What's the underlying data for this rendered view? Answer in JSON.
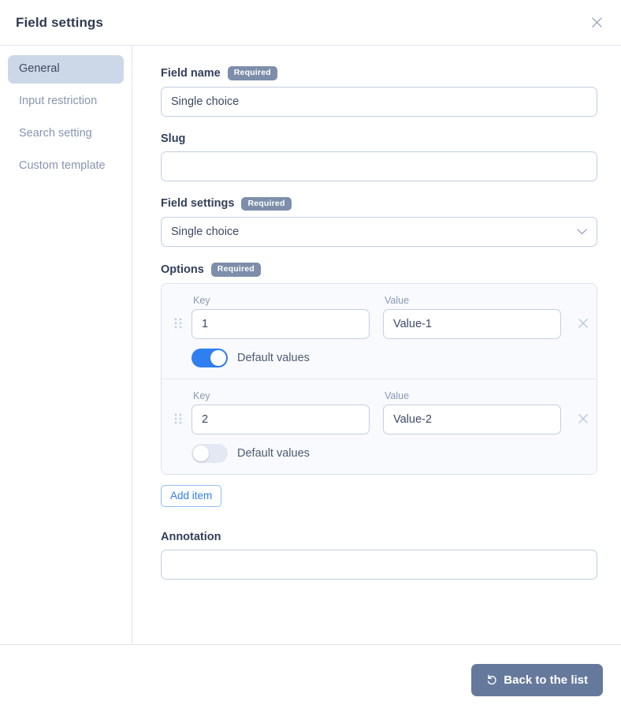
{
  "header": {
    "title": "Field settings",
    "close_icon": "close-icon"
  },
  "sidebar": {
    "items": [
      {
        "label": "General",
        "active": true
      },
      {
        "label": "Input restriction",
        "active": false
      },
      {
        "label": "Search setting",
        "active": false
      },
      {
        "label": "Custom template",
        "active": false
      }
    ]
  },
  "main": {
    "required_badge": "Required",
    "field_name": {
      "label": "Field name",
      "value": "Single choice",
      "placeholder": ""
    },
    "slug": {
      "label": "Slug",
      "value": "",
      "placeholder": ""
    },
    "field_settings": {
      "label": "Field settings",
      "value": "Single choice",
      "chevron_icon": "chevron-down-icon"
    },
    "options": {
      "label": "Options",
      "key_label": "Key",
      "value_label": "Value",
      "toggle_label": "Default values",
      "drag_icon": "drag-handle-icon",
      "remove_icon": "close-icon",
      "rows": [
        {
          "key": "1",
          "value": "Value-1",
          "default_on": true
        },
        {
          "key": "2",
          "value": "Value-2",
          "default_on": false
        }
      ],
      "add_item_label": "Add item"
    },
    "annotation": {
      "label": "Annotation",
      "value": "",
      "placeholder": ""
    }
  },
  "footer": {
    "back_label": "Back to the list",
    "back_icon": "undo-arrow-icon"
  },
  "colors": {
    "accent_blue": "#2f7ff0",
    "badge_slate": "#7d8eaa",
    "button_slate": "#65799c",
    "active_nav": "#ccd8e8",
    "border": "#c3cfe2",
    "panel_bg": "#f8fafd"
  }
}
